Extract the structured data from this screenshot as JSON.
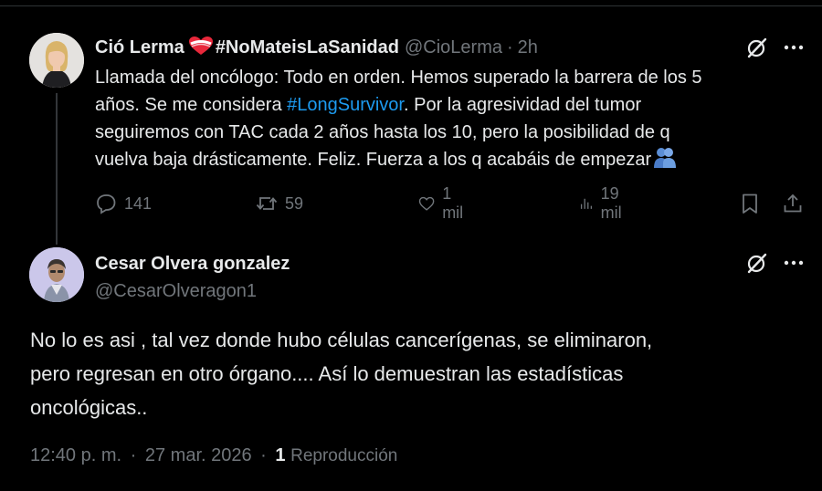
{
  "tweet": {
    "author_name": "Ció Lerma",
    "author_hashtag_name": "#NoMateisLaSanidad",
    "handle": "@CioLerma",
    "separator": "·",
    "time": "2h",
    "text_lines": [
      [
        "Llamada del oncólogo: Todo en orden. Hemos superado la barrera de los 5"
      ],
      [
        "años. Se me considera ",
        "#LongSurvivor",
        ". Por la agresividad del tumor"
      ],
      [
        "seguiremos con TAC cada 2 años hasta los 10,  pero la posibilidad de q"
      ],
      [
        "vuelva baja drásticamente. Feliz. Fuerza a los q acabáis de empezar"
      ]
    ],
    "line1": "Llamada del oncólogo: Todo en orden. Hemos superado la barrera de los 5",
    "line2_a": "años. Se me considera ",
    "line2_hashtag": "#LongSurvivor",
    "line2_b": ". Por la agresividad del tumor",
    "line3": "seguiremos con TAC cada 2 años hasta los 10,  pero la posibilidad de q",
    "line4": "vuelva baja drásticamente. Feliz. Fuerza a los q acabáis de empezar",
    "emoji": "people-hugging-emoji",
    "replies": "141",
    "reposts": "59",
    "likes": "1 mil",
    "views": "19 mil"
  },
  "reply": {
    "author_name": "Cesar Olvera gonzalez",
    "handle": "@CesarOlveragon1",
    "line1": "No lo es asi , tal vez donde hubo células cancerígenas, se eliminaron,",
    "line2": "pero regresan en otro órgano.... Así lo demuestran las estadísticas",
    "line3": "oncológicas..",
    "time": "12:40 p. m.",
    "date": "27 mar. 2026",
    "sep": "·",
    "views_count": "1",
    "views_label": "Reproducción"
  },
  "colors": {
    "background": "#000000",
    "text": "#e7e9ea",
    "muted": "#71767b",
    "accent": "#1d9bf0",
    "divider": "#2f3336"
  },
  "icons": [
    "more-options-icon",
    "grok-icon",
    "reply-icon",
    "repost-icon",
    "like-icon",
    "views-icon",
    "bookmark-icon",
    "share-icon",
    "heart-badge-icon"
  ]
}
